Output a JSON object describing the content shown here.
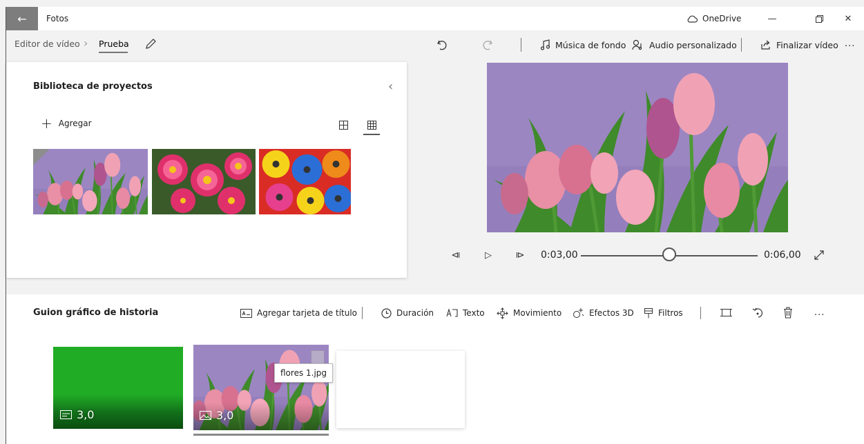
{
  "window": {
    "title": "Fotos",
    "onedrive_label": "OneDrive"
  },
  "toolbar": {
    "breadcrumb_root": "Editor de vídeo",
    "breadcrumb_current": "Prueba",
    "background_music": "Música de fondo",
    "custom_audio": "Audio personalizado",
    "finish_video": "Finalizar vídeo",
    "more": "..."
  },
  "library": {
    "title": "Biblioteca de proyectos",
    "add_label": "Agregar",
    "items": [
      {
        "name": "tulips"
      },
      {
        "name": "pink-daisies"
      },
      {
        "name": "colorful-gerberas"
      }
    ]
  },
  "player": {
    "current_time": "0:03,00",
    "total_time": "0:06,00",
    "progress": 0.5
  },
  "storyboard": {
    "title": "Guion gráfico de historia",
    "actions": {
      "add_title_card": "Agregar tarjeta de título",
      "duration": "Duración",
      "text": "Texto",
      "motion": "Movimiento",
      "effects_3d": "Efectos 3D",
      "filters": "Filtros",
      "more": "..."
    },
    "cards": [
      {
        "duration": "3,0",
        "color": "#21ac25"
      },
      {
        "duration": "3,0",
        "tooltip": "flores 1.jpg"
      }
    ]
  },
  "colors": {
    "accent_green": "#21ac25",
    "titlebar_back": "#7d7d7d",
    "tulip_bg": "#9b86c2"
  }
}
